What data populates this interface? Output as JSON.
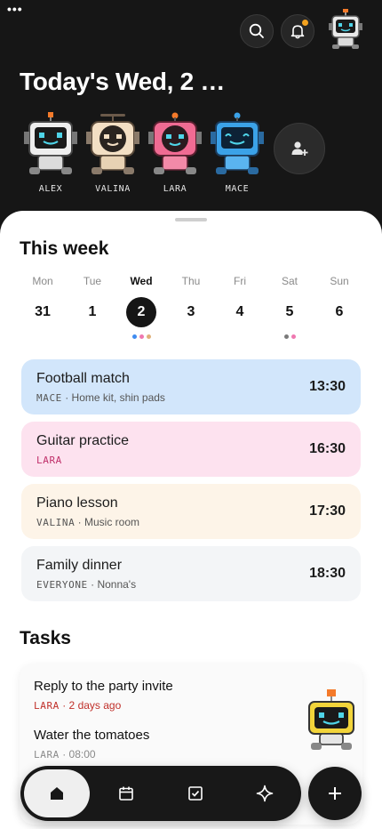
{
  "status": {
    "menu_dots": "•••"
  },
  "header": {
    "title": "Today's Wed, 2 …",
    "buttons": {
      "search_icon": "search-icon",
      "bell_icon": "bell-icon"
    },
    "notification_color": "#f3a21f"
  },
  "members": [
    {
      "name": "ALEX",
      "color": "#e8e8e8"
    },
    {
      "name": "VALINA",
      "color": "#f3dfc4"
    },
    {
      "name": "LARA",
      "color": "#f06b93"
    },
    {
      "name": "MACE",
      "color": "#3ba2e8"
    }
  ],
  "add_member_icon": "add-person-icon",
  "week": {
    "title": "This week",
    "days": [
      {
        "dow": "Mon",
        "date": "31",
        "active": false,
        "dots": []
      },
      {
        "dow": "Tue",
        "date": "1",
        "active": false,
        "dots": []
      },
      {
        "dow": "Wed",
        "date": "2",
        "active": true,
        "dots": [
          "#3f8cf0",
          "#ef78b0",
          "#e0b07a"
        ]
      },
      {
        "dow": "Thu",
        "date": "3",
        "active": false,
        "dots": []
      },
      {
        "dow": "Fri",
        "date": "4",
        "active": false,
        "dots": []
      },
      {
        "dow": "Sat",
        "date": "5",
        "active": false,
        "dots": [
          "#7a7a7a",
          "#ef78b0"
        ]
      },
      {
        "dow": "Sun",
        "date": "6",
        "active": false,
        "dots": []
      }
    ]
  },
  "events": [
    {
      "title": "Football match",
      "who": "MACE",
      "detail": " · Home kit, shin pads",
      "time": "13:30",
      "bg": "#d2e6fb",
      "who_color": "#555555"
    },
    {
      "title": "Guitar practice",
      "who": "LARA",
      "detail": "",
      "time": "16:30",
      "bg": "#fde2ef",
      "who_color": "#c0306a"
    },
    {
      "title": "Piano lesson",
      "who": "VALINA",
      "detail": " · Music room",
      "time": "17:30",
      "bg": "#fdf4e8",
      "who_color": "#555555"
    },
    {
      "title": "Family dinner",
      "who": "EVERYONE",
      "detail": " · Nonna's",
      "time": "18:30",
      "bg": "#f3f5f7",
      "who_color": "#555555"
    }
  ],
  "tasks": {
    "title": "Tasks",
    "items": [
      {
        "title": "Reply to the party invite",
        "who": "LARA",
        "meta": " · 2 days ago",
        "color": "#c0302a"
      },
      {
        "title": "Water the tomatoes",
        "who": "LARA",
        "meta": " · 08:00",
        "color": "#8a8a8a"
      }
    ]
  },
  "nav": {
    "items": [
      {
        "icon": "home-icon",
        "active": true
      },
      {
        "icon": "calendar-icon",
        "active": false
      },
      {
        "icon": "checkbox-icon",
        "active": false
      },
      {
        "icon": "sparkle-icon",
        "active": false
      }
    ],
    "fab_icon": "plus-icon"
  }
}
